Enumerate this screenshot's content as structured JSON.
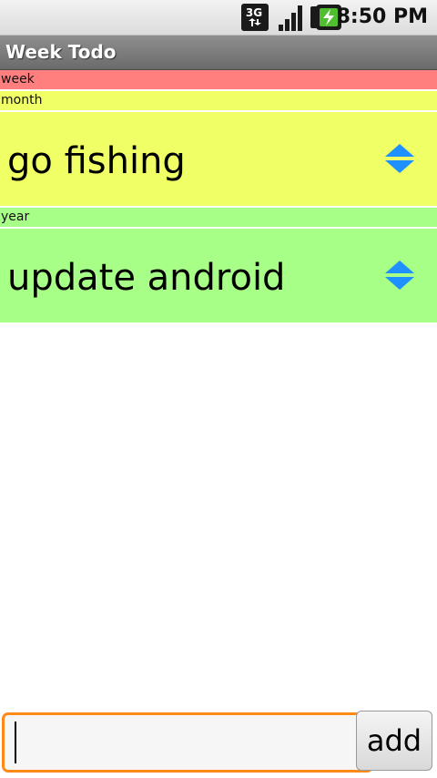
{
  "status_bar": {
    "network_label": "3G",
    "time": "8:50 PM",
    "icons": [
      "network-3g-icon",
      "signal-strength-icon",
      "battery-charging-icon"
    ]
  },
  "app": {
    "title": "Week Todo"
  },
  "list": {
    "sections": [
      {
        "label": "week",
        "color": "#ff7f7f",
        "items": []
      },
      {
        "label": "month",
        "color": "#f0ff66",
        "items": [
          {
            "text": "go fishing",
            "icon": "reorder-arrows-icon"
          }
        ]
      },
      {
        "label": "year",
        "color": "#a8ff88",
        "items": [
          {
            "text": "update android",
            "icon": "reorder-arrows-icon"
          }
        ]
      }
    ]
  },
  "input_bar": {
    "value": "",
    "add_label": "add"
  },
  "colors": {
    "week": "#ff7f7f",
    "month": "#f0ff66",
    "year": "#a8ff88",
    "focus_border": "#ff8a1a",
    "reorder_arrows": "#1e90ff"
  }
}
